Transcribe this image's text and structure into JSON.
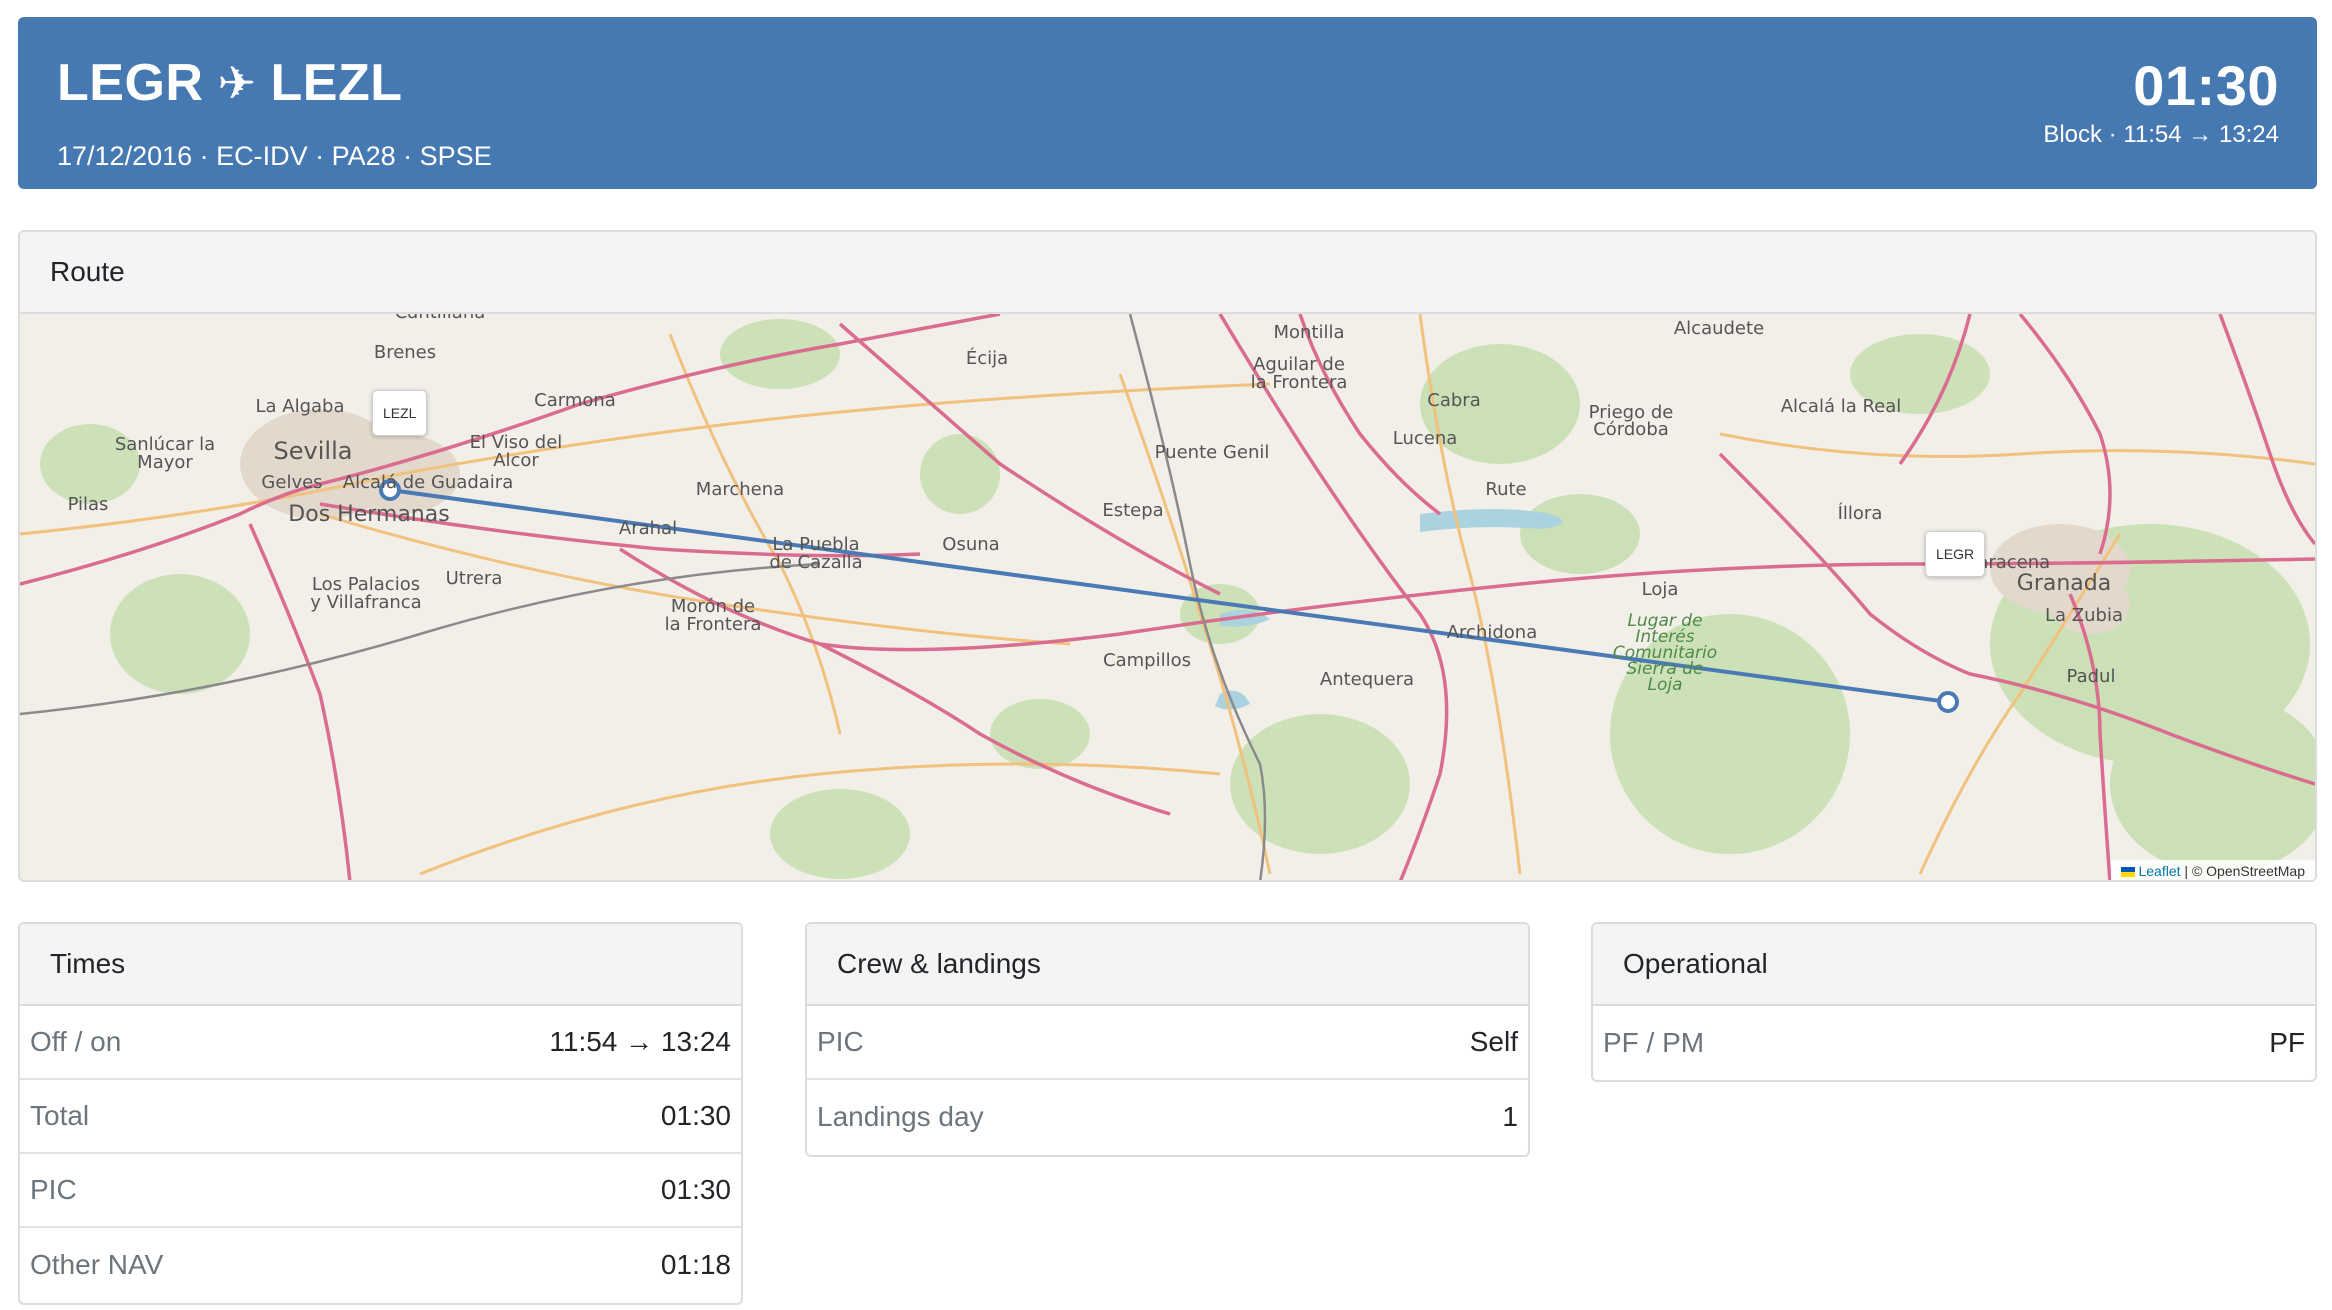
{
  "header": {
    "from": "LEGR",
    "to": "LEZL",
    "plane_glyph": "✈",
    "subtitle": "17/12/2016 · EC-IDV · PA28 · SPSE",
    "block_time": "01:30",
    "block_range": "Block · 11:54 → 13:24"
  },
  "route": {
    "title": "Route",
    "markers": {
      "origin": "LEZL",
      "destination": "LEGR"
    },
    "attribution_leaflet": "Leaflet",
    "attribution_rest": " | © OpenStreetMap",
    "towns": [
      "Cantillana",
      "Brenes",
      "La Algaba",
      "Carmona",
      "Sanlúcar la",
      "Mayor",
      "Sevilla",
      "El Viso del",
      "Alcor",
      "Gelves",
      "Alcalá de Guadaira",
      "Pilas",
      "Dos Hermanas",
      "Marchena",
      "Arahal",
      "La Puebla",
      "de Cazalla",
      "Osuna",
      "Écija",
      "Los Palacios",
      "y Villafranca",
      "Utrera",
      "Morón de",
      "la Frontera",
      "Montilla",
      "Aguilar de",
      "la Frontera",
      "Puente Genil",
      "Estepa",
      "Campillos",
      "Antequera",
      "Cabra",
      "Lucena",
      "Priego de",
      "Córdoba",
      "Alcaudete",
      "Alcalá la Real",
      "Rute",
      "Íllora",
      "Loja",
      "Archidona",
      "Lugar de",
      "Interés",
      "Comunitario",
      "Sierra de",
      "Loja",
      "Maracena",
      "Granada",
      "La Zubia",
      "Padul"
    ],
    "colors": {
      "route_line": "#4a7ab5",
      "main_road": "#d95f84",
      "secondary_road": "#f1c27e",
      "urban": "#e0d7cf",
      "forest": "#b7d9a2",
      "water": "#aad3df"
    }
  },
  "times": {
    "title": "Times",
    "rows": [
      {
        "label": "Off / on",
        "value": "11:54 → 13:24"
      },
      {
        "label": "Total",
        "value": "01:30"
      },
      {
        "label": "PIC",
        "value": "01:30"
      },
      {
        "label": "Other NAV",
        "value": "01:18"
      }
    ]
  },
  "crew": {
    "title": "Crew & landings",
    "rows": [
      {
        "label": "PIC",
        "value": "Self"
      },
      {
        "label": "Landings day",
        "value": "1"
      }
    ]
  },
  "operational": {
    "title": "Operational",
    "rows": [
      {
        "label": "PF / PM",
        "value": "PF"
      }
    ]
  }
}
